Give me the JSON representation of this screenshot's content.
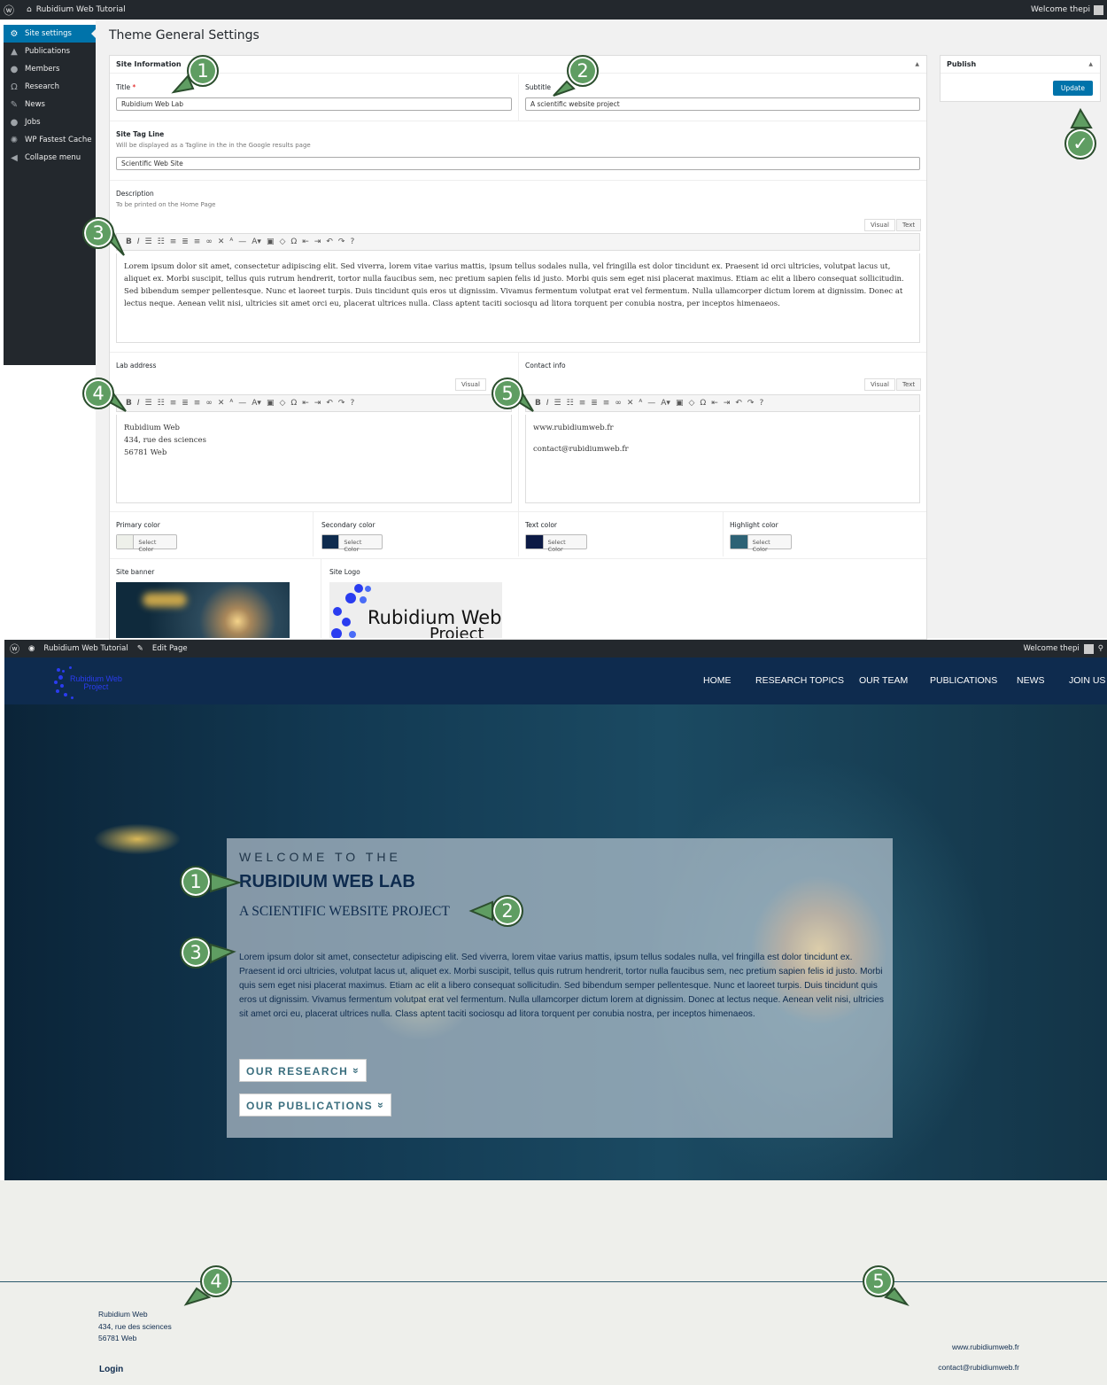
{
  "admin": {
    "admin_bar": {
      "site_name": "Rubidium Web Tutorial",
      "welcome": "Welcome thepi"
    },
    "menu": [
      {
        "label": "Site settings",
        "icon": "gear-icon",
        "active": true
      },
      {
        "label": "Publications",
        "icon": "graduation-cap-icon"
      },
      {
        "label": "Members",
        "icon": "user-icon"
      },
      {
        "label": "Research",
        "icon": "omega-icon"
      },
      {
        "label": "News",
        "icon": "pin-icon"
      },
      {
        "label": "Jobs",
        "icon": "user-icon"
      },
      {
        "label": "WP Fastest Cache",
        "icon": "cheetah-icon"
      },
      {
        "label": "Collapse menu",
        "icon": "collapse-icon"
      }
    ],
    "page_title": "Theme General Settings",
    "site_info": {
      "header": "Site Information",
      "title_label": "Title",
      "required_mark": "*",
      "title_value": "Rubidium Web Lab",
      "subtitle_label": "Subtitle",
      "subtitle_value": "A scientific website project",
      "tagline_label": "Site Tag Line",
      "tagline_hint": "Will be displayed as a Tagline in the in the Google results page",
      "tagline_value": "Scientific Web Site",
      "description_label": "Description",
      "description_hint": "To be printed on the Home Page",
      "tab_visual": "Visual",
      "tab_text": "Text",
      "description_text": "Lorem ipsum dolor sit amet, consectetur adipiscing elit. Sed viverra, lorem vitae varius mattis, ipsum tellus sodales nulla, vel fringilla est dolor tincidunt ex. Praesent id orci ultricies, volutpat lacus ut, aliquet ex. Morbi suscipit, tellus quis rutrum hendrerit, tortor nulla faucibus sem, nec pretium sapien felis id justo. Morbi quis sem eget nisi placerat maximus. Etiam ac elit a libero consequat sollicitudin. Sed bibendum semper pellentesque. Nunc et laoreet turpis. Duis tincidunt quis eros ut dignissim. Vivamus fermentum volutpat erat vel fermentum. Nulla ullamcorper dictum lorem at dignissim. Donec at lectus neque. Aenean velit nisi, ultricies sit amet orci eu, placerat ultrices nulla. Class aptent taciti sociosqu ad litora torquent per conubia nostra, per inceptos himenaeos.",
      "lab_address_label": "Lab address",
      "lab_address_lines": [
        "Rubidium Web",
        "434, rue des sciences",
        "56781 Web"
      ],
      "contact_label": "Contact info",
      "contact_lines": [
        "www.rubidiumweb.fr",
        "contact@rubidiumweb.fr"
      ],
      "colors": [
        {
          "label": "Primary color",
          "button": "Select Color",
          "value": "#eef0ea"
        },
        {
          "label": "Secondary color",
          "button": "Select Color",
          "value": "#0e2b4e"
        },
        {
          "label": "Text color",
          "button": "Select Color",
          "value": "#0c1a45"
        },
        {
          "label": "Highlight color",
          "button": "Select Color",
          "value": "#2d6275"
        }
      ],
      "banner_label": "Site banner",
      "logo_label": "Site Logo",
      "logo_text_1": "Rubidium Web",
      "logo_text_2": "Project"
    },
    "publish": {
      "header": "Publish",
      "button": "Update"
    }
  },
  "site": {
    "admin_bar": {
      "site_name": "Rubidium Web Tutorial",
      "edit": "Edit Page",
      "welcome": "Welcome thepi"
    },
    "logo_text": [
      "Rubidium Web",
      "Project"
    ],
    "nav": [
      "HOME",
      "RESEARCH TOPICS",
      "OUR TEAM",
      "PUBLICATIONS",
      "NEWS",
      "JOIN US"
    ],
    "hero": {
      "welcome": "WELCOME TO THE",
      "title": "RUBIDIUM WEB LAB",
      "subtitle": "A SCIENTIFIC WEBSITE PROJECT",
      "description": "Lorem ipsum dolor sit amet, consectetur adipiscing elit. Sed viverra, lorem vitae varius mattis, ipsum tellus sodales nulla, vel fringilla est dolor tincidunt ex. Praesent id orci ultricies, volutpat lacus ut, aliquet ex. Morbi suscipit, tellus quis rutrum hendrerit, tortor nulla faucibus sem, nec pretium sapien felis id justo. Morbi quis sem eget nisi placerat maximus. Etiam ac elit a libero consequat sollicitudin. Sed bibendum semper pellentesque. Nunc et laoreet turpis. Duis tincidunt quis eros ut dignissim. Vivamus fermentum volutpat erat vel fermentum. Nulla ullamcorper dictum lorem at dignissim. Donec at lectus neque. Aenean velit nisi, ultricies sit amet orci eu, placerat ultrices nulla. Class aptent taciti sociosqu ad litora torquent per conubia nostra, per inceptos himenaeos.",
      "btn_research": "OUR RESEARCH",
      "btn_publications": "OUR PUBLICATIONS",
      "btn_chevron": "»"
    },
    "footer": {
      "address": [
        "Rubidium Web",
        "434, rue des sciences",
        "56781 Web"
      ],
      "login": "Login",
      "web": "www.rubidiumweb.fr",
      "email": "contact@rubidiumweb.fr"
    }
  },
  "callouts": [
    "1",
    "2",
    "3",
    "4",
    "5"
  ],
  "check_icon": "checkmark-icon"
}
